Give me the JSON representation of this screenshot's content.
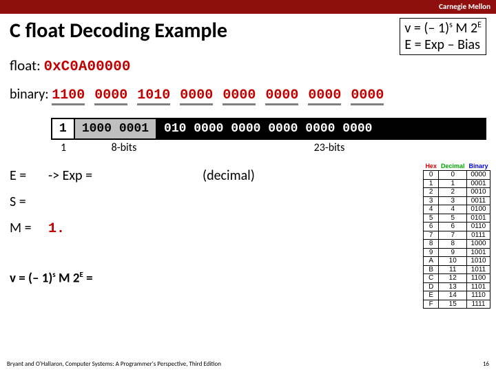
{
  "header": {
    "org": "Carnegie Mellon"
  },
  "title": "C float Decoding Example",
  "formula": {
    "line1_pre": "v = (– 1)",
    "line1_sup1": "s",
    "line1_mid": " M  2",
    "line1_sup2": "E",
    "line2": "E  =  Exp – Bias"
  },
  "floatline": {
    "label": "float: ",
    "value": "0xC0A00000"
  },
  "binary": {
    "label": "binary: ",
    "groups": [
      "1100",
      "0000",
      "1010",
      "0000",
      "0000",
      "0000",
      "0000",
      "0000"
    ]
  },
  "bits": {
    "sign": "1",
    "exp": "1000 0001",
    "mant": "010 0000 0000 0000 0000 0000"
  },
  "bitlabels": {
    "sign": "1",
    "exp": "8-bits",
    "mant": "23-bits"
  },
  "body": {
    "E_label": "E =",
    "E_expr": "-> Exp =",
    "decimal_word": "(decimal)",
    "S_label": "S =",
    "M_label": "M = ",
    "M_val": "1."
  },
  "value_line": {
    "pre": "v = (– 1)",
    "sup1": "s",
    "mid": " M  2",
    "sup2": "E",
    "post": " = "
  },
  "hex_table": {
    "heads": [
      "Hex",
      "Decimal",
      "Binary"
    ],
    "rows": [
      [
        "0",
        "0",
        "0000"
      ],
      [
        "1",
        "1",
        "0001"
      ],
      [
        "2",
        "2",
        "0010"
      ],
      [
        "3",
        "3",
        "0011"
      ],
      [
        "4",
        "4",
        "0100"
      ],
      [
        "5",
        "5",
        "0101"
      ],
      [
        "6",
        "6",
        "0110"
      ],
      [
        "7",
        "7",
        "0111"
      ],
      [
        "8",
        "8",
        "1000"
      ],
      [
        "9",
        "9",
        "1001"
      ],
      [
        "A",
        "10",
        "1010"
      ],
      [
        "B",
        "11",
        "1011"
      ],
      [
        "C",
        "12",
        "1100"
      ],
      [
        "D",
        "13",
        "1101"
      ],
      [
        "E",
        "14",
        "1110"
      ],
      [
        "F",
        "15",
        "1111"
      ]
    ]
  },
  "footer": {
    "credit": "Bryant and O'Hallaron, Computer Systems: A Programmer's Perspective, Third Edition",
    "page": "16"
  }
}
